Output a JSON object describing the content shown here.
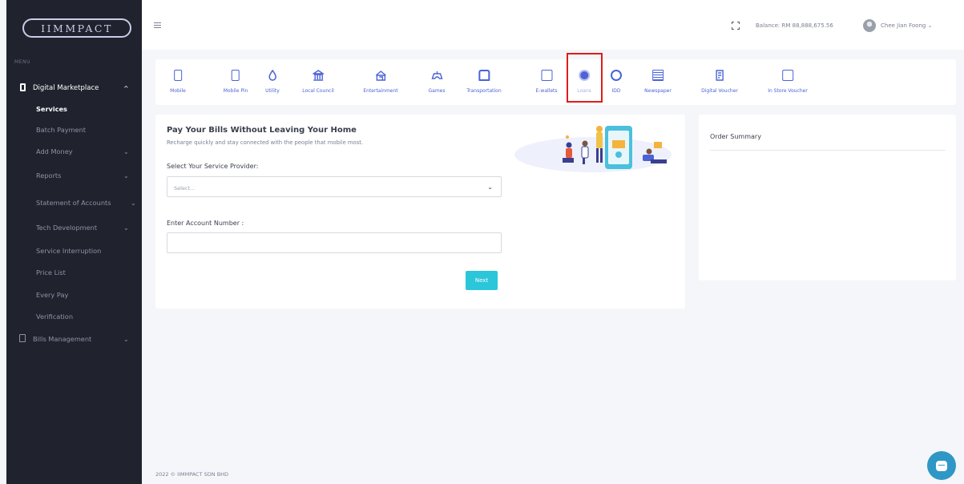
{
  "brand": {
    "logo_text": "IIMMPACT"
  },
  "sidebar": {
    "menu_title": "MENU",
    "items": [
      {
        "label": "Digital Marketplace",
        "chevron": "^"
      },
      {
        "label": "Services"
      },
      {
        "label": "Batch Payment"
      },
      {
        "label": "Add Money",
        "chevron": "⌄"
      },
      {
        "label": "Reports",
        "chevron": "⌄"
      },
      {
        "label": "Statement of Accounts",
        "chevron": "⌄"
      },
      {
        "label": "Tech Development",
        "chevron": "⌄"
      },
      {
        "label": "Service Interruption"
      },
      {
        "label": "Price List"
      },
      {
        "label": "Every Pay"
      },
      {
        "label": "Verification"
      },
      {
        "label": "Bills Management",
        "chevron": "⌄"
      }
    ]
  },
  "topbar": {
    "balance": "Balance: RM 88,888,675.56",
    "username": "Chee Jian Foong ⌄"
  },
  "categories": [
    {
      "label": "Mobile",
      "icon": "mobile-icon"
    },
    {
      "label": "Mobile Pin",
      "icon": "mobile-pin-icon"
    },
    {
      "label": "Utility",
      "icon": "utility-drop-icon"
    },
    {
      "label": "Local Council",
      "icon": "council-building-icon"
    },
    {
      "label": "Entertainment",
      "icon": "entertainment-icon"
    },
    {
      "label": "Games",
      "icon": "games-icon"
    },
    {
      "label": "Transportation",
      "icon": "bus-icon"
    },
    {
      "label": "E-wallets",
      "icon": "wallet-icon"
    },
    {
      "label": "Loans",
      "icon": "coin-icon"
    },
    {
      "label": "IDD",
      "icon": "globe-icon"
    },
    {
      "label": "Newspaper",
      "icon": "newspaper-icon"
    },
    {
      "label": "Digital Voucher",
      "icon": "digital-voucher-icon"
    },
    {
      "label": "In Store Voucher",
      "icon": "store-voucher-icon"
    }
  ],
  "form": {
    "title": "Pay Your Bills Without Leaving Your Home",
    "subtitle": "Recharge quickly and stay connected with the people that mobile most.",
    "provider_label": "Select Your Service Provider:",
    "provider_placeholder": "Select...",
    "account_label": "Enter Account Number :",
    "account_value": "",
    "next_label": "Next"
  },
  "summary": {
    "title": "Order Summary"
  },
  "footer": {
    "text": "2022 © IIMMPACT SDN BHD"
  },
  "colors": {
    "sidebar": "#20222e",
    "accent": "#4a64d6",
    "button": "#2bc6d9",
    "highlight": "#e01b1b"
  }
}
